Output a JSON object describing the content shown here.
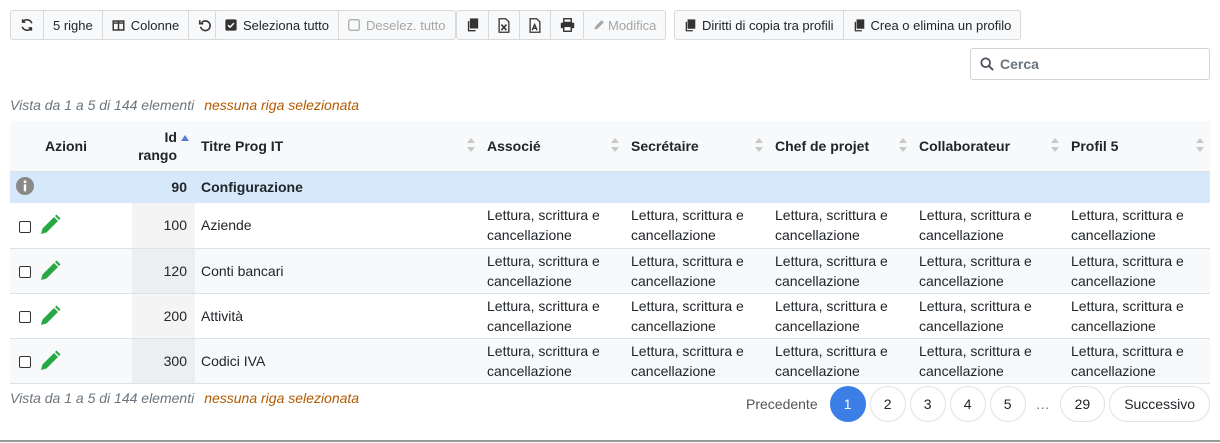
{
  "toolbar": {
    "rows_label": "5 righe",
    "columns_label": "Colonne",
    "select_all_label": "Seleziona tutto",
    "deselect_all_label": "Deselez. tutto",
    "edit_label": "Modifica",
    "copy_rights_label": "Diritti di copia tra profili",
    "create_delete_label": "Crea o elimina un profilo"
  },
  "search": {
    "placeholder": "Cerca"
  },
  "info": {
    "count_text": "Vista da 1 a 5 di 144 elementi",
    "selection_text": "nessuna riga selezionata"
  },
  "table": {
    "headers": {
      "actions": "Azioni",
      "id_line1": "Id",
      "id_line2": "rango",
      "title": "Titre Prog IT",
      "col1": "Associé",
      "col2": "Secrétaire",
      "col3": "Chef de projet",
      "col4": "Collaborateur",
      "col5": "Profil 5"
    },
    "group": {
      "id": "90",
      "name": "Configurazione"
    },
    "rows": [
      {
        "id": "100",
        "name": "Aziende",
        "perm_line1": "Lettura, scrittura e",
        "perm_line2": "cancellazione"
      },
      {
        "id": "120",
        "name": "Conti bancari",
        "perm_line1": "Lettura, scrittura e",
        "perm_line2": "cancellazione"
      },
      {
        "id": "200",
        "name": "Attività",
        "perm_line1": "Lettura, scrittura e",
        "perm_line2": "cancellazione"
      },
      {
        "id": "300",
        "name": "Codici IVA",
        "perm_line1": "Lettura, scrittura e",
        "perm_line2": "cancellazione"
      }
    ]
  },
  "pagination": {
    "prev": "Precedente",
    "pages": [
      "1",
      "2",
      "3",
      "4",
      "5"
    ],
    "ellipsis": "…",
    "last": "29",
    "next": "Successivo"
  },
  "colors": {
    "accent": "#3a7ee6",
    "group_row": "#d6e9fb",
    "edit_icon": "#28a745",
    "selection_text": "#b35900"
  }
}
